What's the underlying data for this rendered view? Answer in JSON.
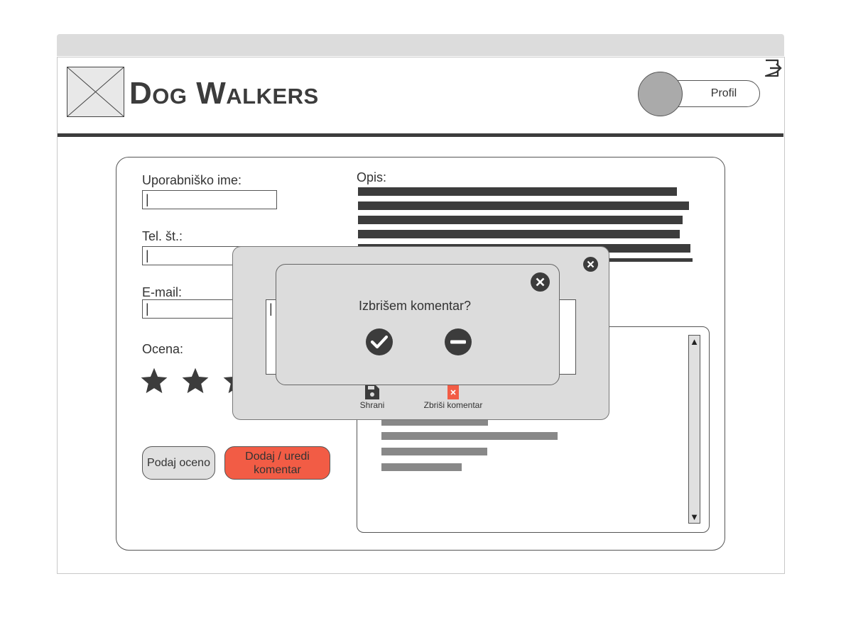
{
  "app": {
    "brand": "Dog Walkers",
    "profile_label": "Profil"
  },
  "form": {
    "username_label": "Uporabniško ime:",
    "username_value": "|",
    "phone_label": "Tel. št.:",
    "phone_value": "|",
    "email_label": "E-mail:",
    "email_value": "|",
    "rating_label": "Ocena:",
    "rating_stars_shown": 3,
    "rate_button": "Podaj oceno",
    "comment_button": "Dodaj / uredi komentar"
  },
  "description": {
    "label": "Opis:"
  },
  "comment_modal": {
    "input_value": "|",
    "save_label": "Shrani",
    "delete_label": "Zbriši komentar"
  },
  "confirm_dialog": {
    "question": "Izbrišem komentar?"
  },
  "colors": {
    "accent_red": "#f25c45",
    "dark": "#3c3c3c",
    "panel_gray": "#dcdcdc"
  },
  "icons": {
    "logout": "logout-icon",
    "close": "close-icon",
    "confirm": "checkmark-icon",
    "cancel": "minus-icon",
    "save": "floppy-disk-icon",
    "delete": "delete-file-icon",
    "star": "star-icon",
    "scroll_up": "arrow-up-icon",
    "scroll_down": "arrow-down-icon"
  }
}
